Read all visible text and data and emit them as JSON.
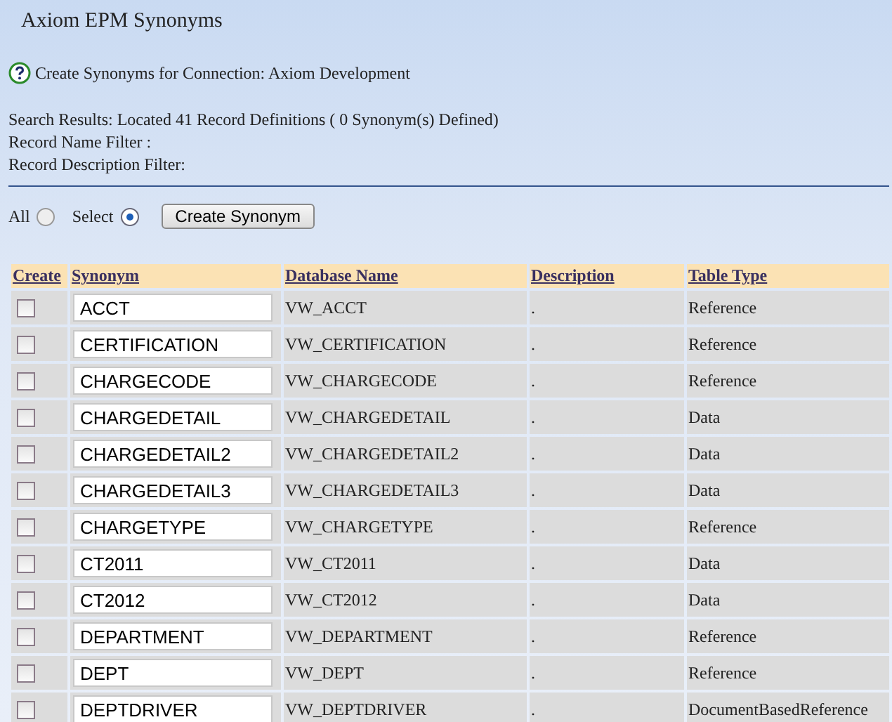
{
  "title": "Axiom EPM Synonyms",
  "subtitle": "Create Synonyms for Connection: Axiom Development",
  "info_lines": [
    "Search Results: Located 41 Record Definitions ( 0 Synonym(s) Defined)",
    "Record Name Filter :",
    "Record Description Filter:"
  ],
  "radios": [
    {
      "label": "All",
      "selected": false
    },
    {
      "label": "Select",
      "selected": true
    }
  ],
  "create_button": "Create Synonym",
  "table": {
    "columns": [
      "Create",
      "Synonym",
      "Database Name",
      "Description",
      "Table Type"
    ],
    "rows": [
      {
        "checked": false,
        "synonym": "ACCT",
        "database_name": "VW_ACCT",
        "description": ".",
        "table_type": "Reference"
      },
      {
        "checked": false,
        "synonym": "CERTIFICATION",
        "database_name": "VW_CERTIFICATION",
        "description": ".",
        "table_type": "Reference"
      },
      {
        "checked": false,
        "synonym": "CHARGECODE",
        "database_name": "VW_CHARGECODE",
        "description": ".",
        "table_type": "Reference"
      },
      {
        "checked": false,
        "synonym": "CHARGEDETAIL",
        "database_name": "VW_CHARGEDETAIL",
        "description": ".",
        "table_type": "Data"
      },
      {
        "checked": false,
        "synonym": "CHARGEDETAIL2",
        "database_name": "VW_CHARGEDETAIL2",
        "description": ".",
        "table_type": "Data"
      },
      {
        "checked": false,
        "synonym": "CHARGEDETAIL3",
        "database_name": "VW_CHARGEDETAIL3",
        "description": ".",
        "table_type": "Data"
      },
      {
        "checked": false,
        "synonym": "CHARGETYPE",
        "database_name": "VW_CHARGETYPE",
        "description": ".",
        "table_type": "Reference"
      },
      {
        "checked": false,
        "synonym": "CT2011",
        "database_name": "VW_CT2011",
        "description": ".",
        "table_type": "Data"
      },
      {
        "checked": false,
        "synonym": "CT2012",
        "database_name": "VW_CT2012",
        "description": ".",
        "table_type": "Data"
      },
      {
        "checked": false,
        "synonym": "DEPARTMENT",
        "database_name": "VW_DEPARTMENT",
        "description": ".",
        "table_type": "Reference"
      },
      {
        "checked": false,
        "synonym": "DEPT",
        "database_name": "VW_DEPT",
        "description": ".",
        "table_type": "Reference"
      },
      {
        "checked": false,
        "synonym": "DEPTDRIVER",
        "database_name": "VW_DEPTDRIVER",
        "description": ".",
        "table_type": "DocumentBasedReference"
      }
    ]
  }
}
